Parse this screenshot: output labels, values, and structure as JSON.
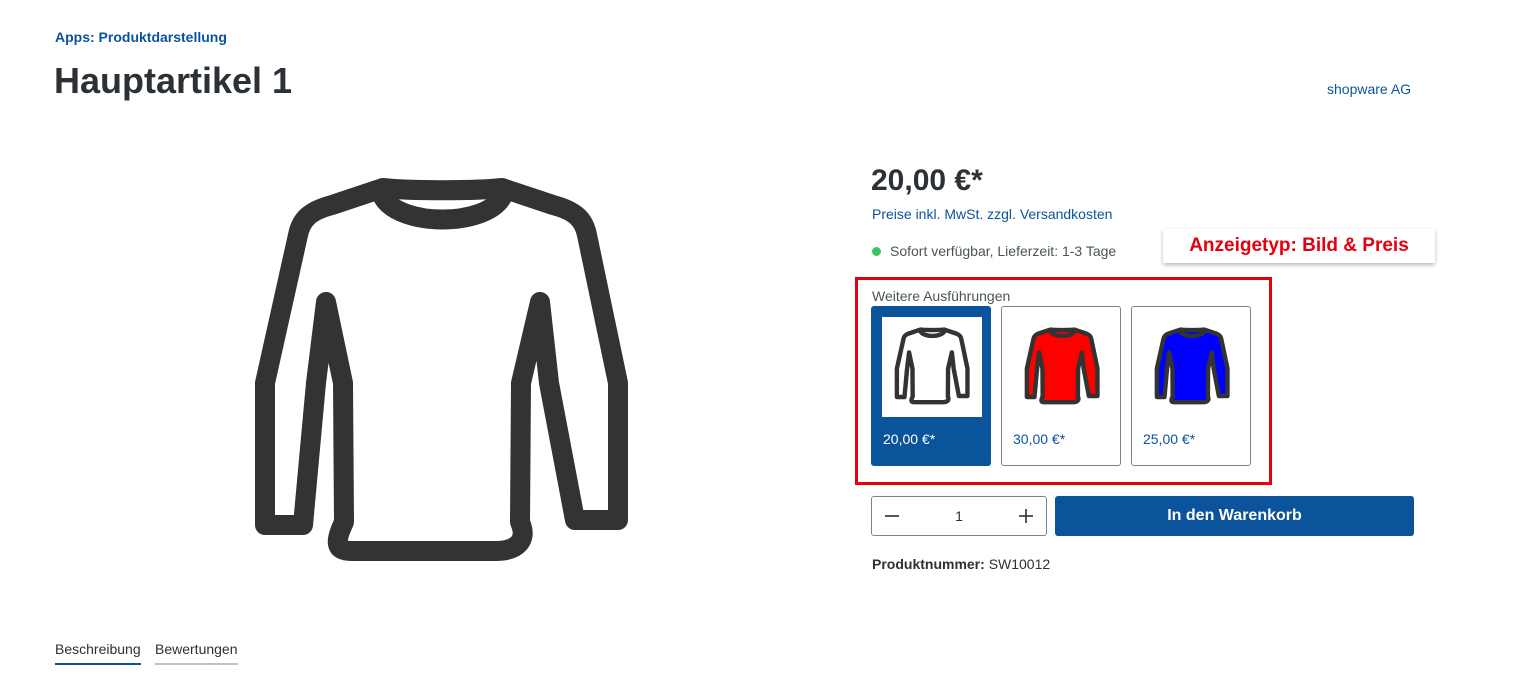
{
  "breadcrumb": "Apps: Produktdarstellung",
  "product": {
    "title": "Hauptartikel 1",
    "manufacturer": "shopware AG",
    "price": "20,00 €*",
    "tax_info": "Preise inkl. MwSt. zzgl. Versandkosten",
    "delivery": "Sofort verfügbar, Lieferzeit: 1-3 Tage",
    "product_number_label": "Produktnummer:",
    "product_number": "SW10012"
  },
  "annotation": {
    "label": "Anzeigetyp: Bild & Preis",
    "color": "#e3000f"
  },
  "variants": {
    "heading": "Weitere Ausführungen",
    "items": [
      {
        "price": "20,00 €*",
        "color": "#ffffff",
        "selected": true
      },
      {
        "price": "30,00 €*",
        "color": "#ff0000",
        "selected": false
      },
      {
        "price": "25,00 €*",
        "color": "#0000ff",
        "selected": false
      }
    ]
  },
  "buy": {
    "quantity": "1",
    "button_label": "In den Warenkorb"
  },
  "tabs": [
    {
      "label": "Beschreibung",
      "active": true
    },
    {
      "label": "Bewertungen",
      "active": false
    }
  ],
  "colors": {
    "brand": "#0b539b",
    "text": "#2b3136",
    "available": "#3cc261"
  }
}
